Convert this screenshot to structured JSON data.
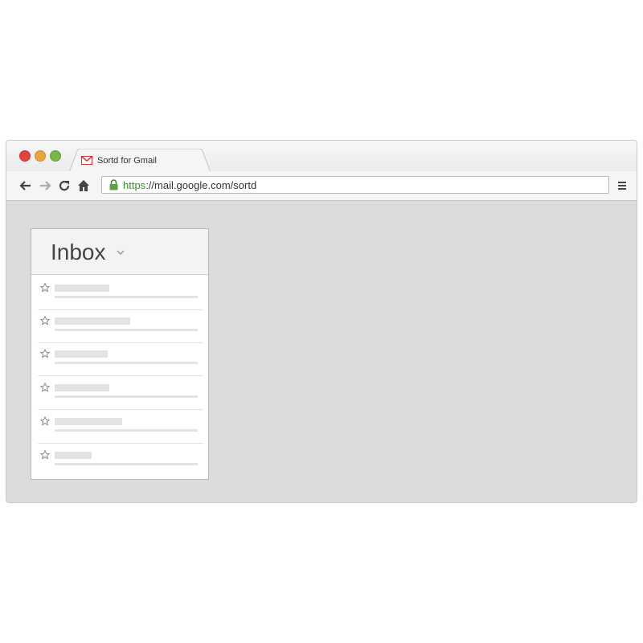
{
  "browser": {
    "tab_title": "Sortd for Gmail",
    "url_scheme": "https",
    "url_rest": "://mail.google.com/sortd",
    "traffic_lights": [
      "#e0443e",
      "#e9a53a",
      "#7ab648"
    ],
    "nav_icons": [
      "back-arrow-icon",
      "forward-arrow-icon",
      "reload-icon",
      "home-icon"
    ],
    "menu_icon": "hamburger-menu-icon"
  },
  "inbox": {
    "title": "Inbox",
    "rows": [
      {
        "starred": false
      },
      {
        "starred": false
      },
      {
        "starred": false
      },
      {
        "starred": false
      },
      {
        "starred": false
      },
      {
        "starred": false
      }
    ]
  }
}
